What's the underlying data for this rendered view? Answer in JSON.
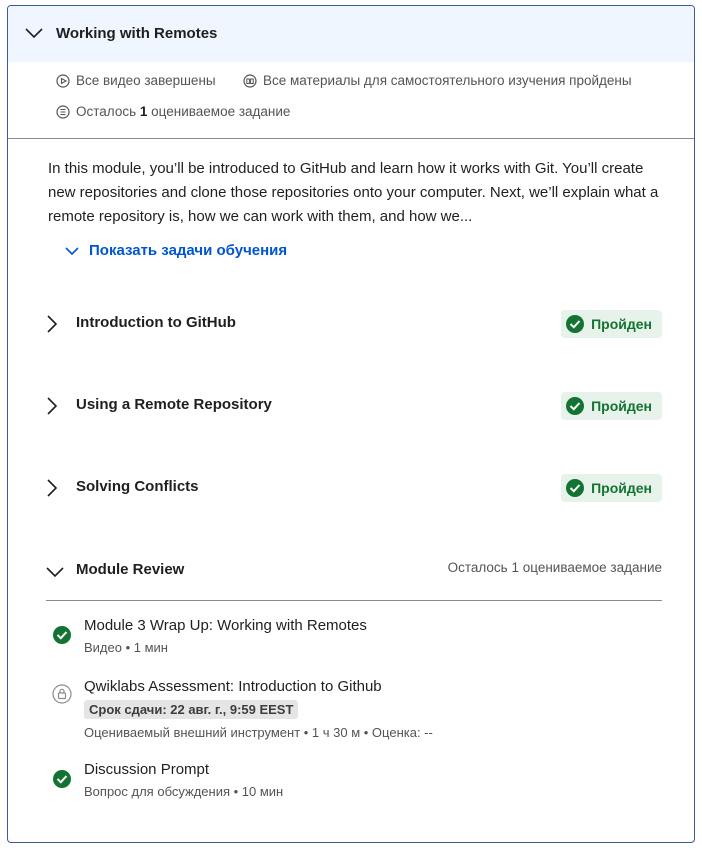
{
  "module": {
    "title": "Working with Remotes",
    "meta": {
      "videos": "Все видео завершены",
      "readings": "Все материалы для самостоятельного изучения пройдены",
      "graded_prefix": "Осталось",
      "graded_count": "1",
      "graded_suffix": "оцениваемое задание"
    },
    "description": "In this module, you’ll be introduced to GitHub and learn how it works with Git. You’ll create new repositories and clone those repositories onto your computer. Next, we’ll explain what a remote repository is, how we can work with them, and how we...",
    "show_goals": "Показать задачи обучения"
  },
  "lessons": [
    {
      "name": "Introduction to GitHub",
      "status": "Пройден"
    },
    {
      "name": "Using a Remote Repository",
      "status": "Пройден"
    },
    {
      "name": "Solving Conflicts",
      "status": "Пройден"
    }
  ],
  "review": {
    "title": "Module Review",
    "remaining": "Осталось 1 оцениваемое задание",
    "items": [
      {
        "title": "Module 3 Wrap Up: Working with Remotes",
        "sub": "Видео • 1 мин",
        "icon": "check-circle-icon"
      },
      {
        "title": "Qwiklabs Assessment: Introduction to Github",
        "deadline": "Срок сдачи: 22 авг. г., 9:59 EEST",
        "sub": "Оцениваемый внешний инструмент • 1 ч 30 м • Оценка: --",
        "icon": "lock-icon"
      },
      {
        "title": "Discussion Prompt",
        "sub": "Вопрос для обсуждения • 10 мин",
        "icon": "check-circle-icon"
      }
    ]
  },
  "colors": {
    "accent": "#0056d2",
    "success": "#137333",
    "success_bg": "#e6f2ea",
    "header_bg": "#f0f6ff"
  }
}
